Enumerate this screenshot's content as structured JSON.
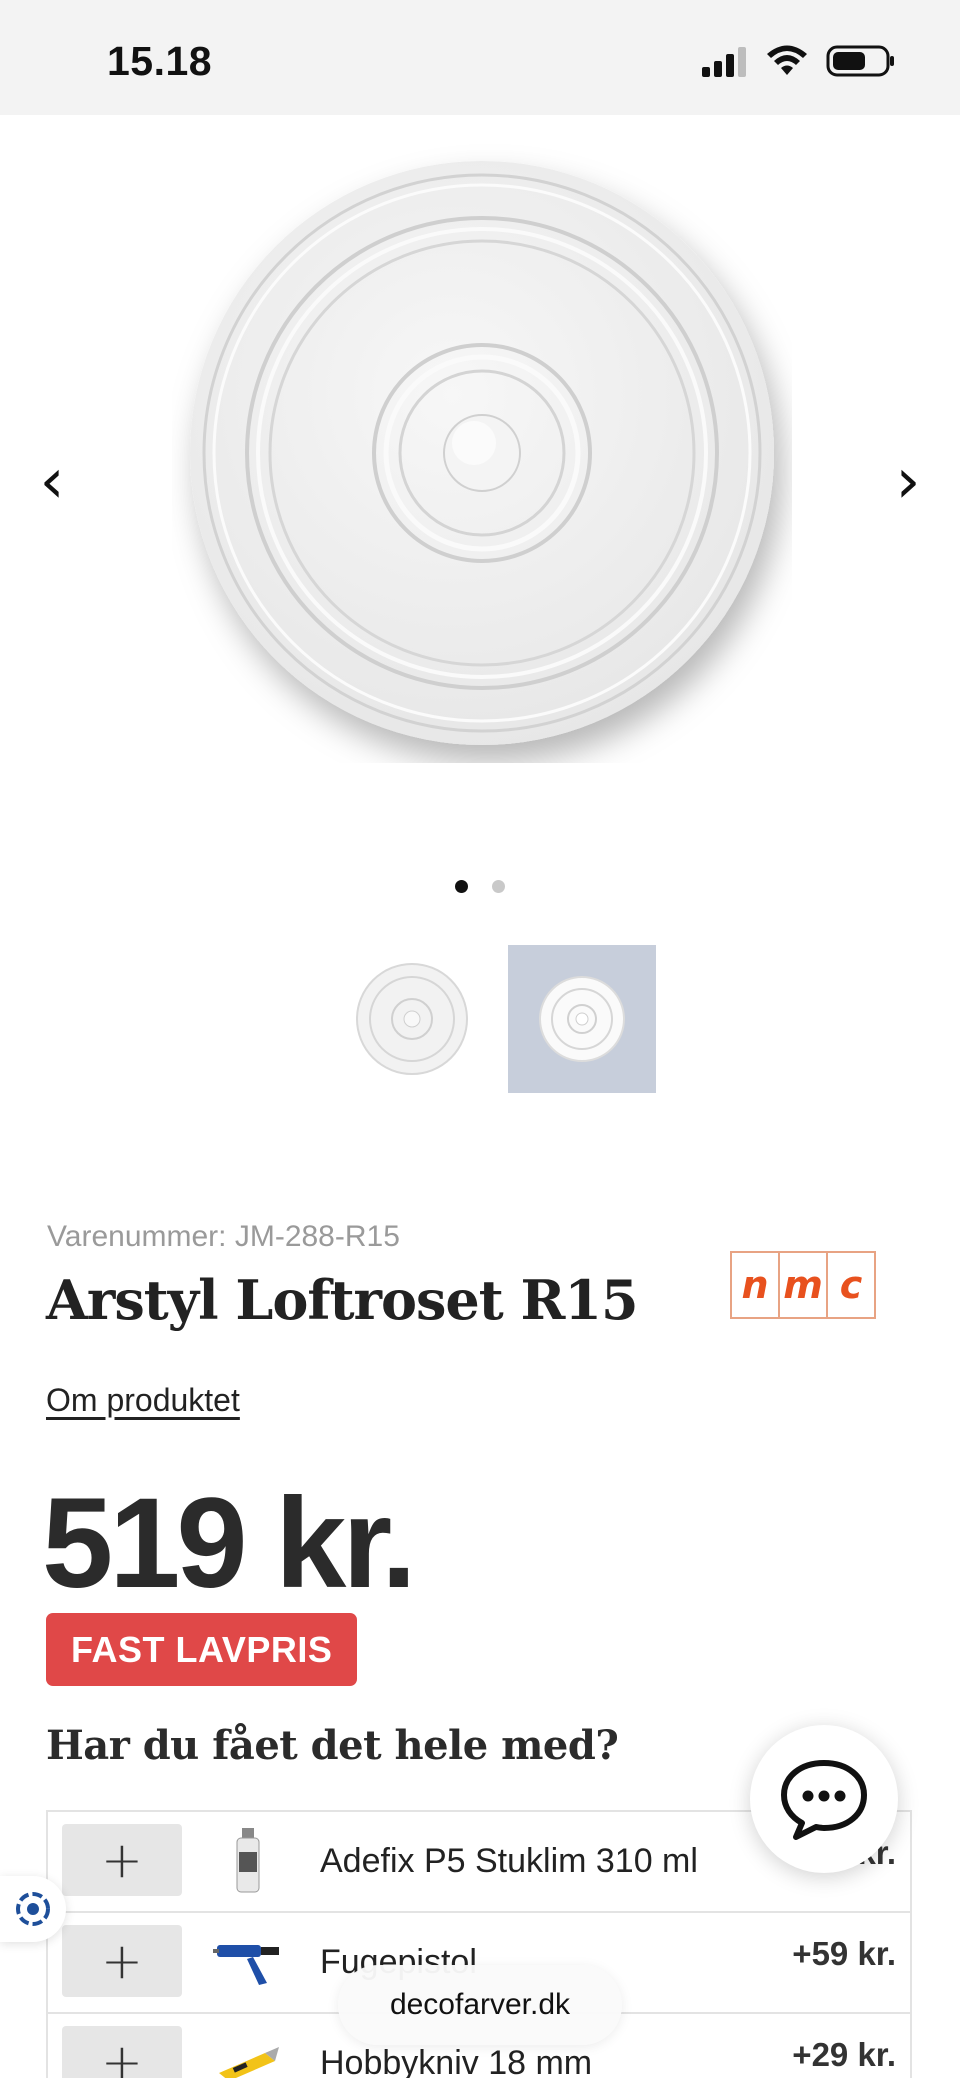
{
  "status_bar": {
    "time": "15.18"
  },
  "gallery": {
    "prev_label": "‹",
    "next_label": "›",
    "slide_count": 2,
    "active_slide": 1
  },
  "product": {
    "sku_label": "Varenummer: JM-288-R15",
    "title": "Arstyl Loftroset R15",
    "brand_letters": [
      "n",
      "m",
      "c"
    ],
    "about_link": "Om produktet",
    "price": "519 kr.",
    "badge": "FAST LAVPRIS"
  },
  "addons": {
    "title": "Har du fået det hele med?",
    "add_symbol": "+",
    "items": [
      {
        "name": "Adefix P5 Stuklim 310 ml",
        "price": "kr."
      },
      {
        "name": "Fugepistol",
        "price": "+59 kr."
      },
      {
        "name": "Hobbykniv 18 mm",
        "price": "+29 kr."
      }
    ]
  },
  "browser": {
    "url": "decofarver.dk"
  },
  "colors": {
    "badge": "#e04848",
    "brand": "#e8511e"
  }
}
